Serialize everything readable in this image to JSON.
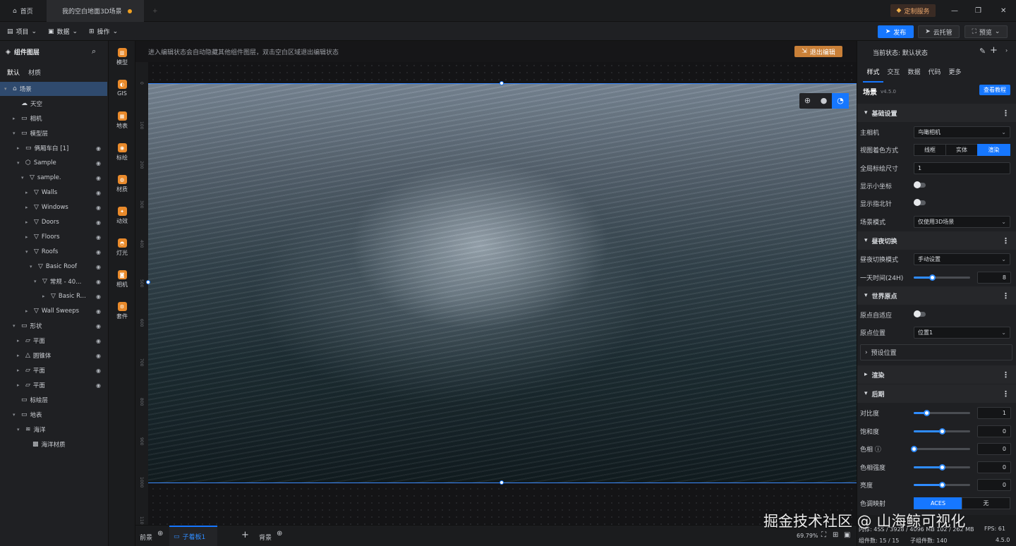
{
  "titlebar": {
    "home_tab": "首页",
    "scene_tab": "我的空白地面3D场景",
    "add_tab": "+",
    "custom_service": "定制服务",
    "min": "—",
    "max": "❐",
    "close": "✕"
  },
  "menubar": {
    "items": [
      "项目",
      "数据",
      "操作"
    ],
    "publish": "发布",
    "cloud_host": "云托管",
    "preview": "预览"
  },
  "layers": {
    "title": "组件图层",
    "tabs": [
      "默认",
      "材质"
    ],
    "items": [
      {
        "label": "场景",
        "icon": "scene"
      },
      {
        "label": "天空",
        "icon": "sky"
      },
      {
        "label": "相机",
        "icon": "folder"
      },
      {
        "label": "模型层",
        "icon": "folder"
      },
      {
        "label": "俩厢车白 [1]",
        "icon": "folder"
      },
      {
        "label": "Sample",
        "icon": "cube"
      },
      {
        "label": "sample.",
        "icon": "node"
      },
      {
        "label": "Walls",
        "icon": "node"
      },
      {
        "label": "Windows",
        "icon": "node"
      },
      {
        "label": "Doors",
        "icon": "node"
      },
      {
        "label": "Floors",
        "icon": "node"
      },
      {
        "label": "Roofs",
        "icon": "node"
      },
      {
        "label": "Basic Roof",
        "icon": "node"
      },
      {
        "label": "常规 - 40...",
        "icon": "node"
      },
      {
        "label": "Basic R...",
        "icon": "node"
      },
      {
        "label": "Wall Sweeps",
        "icon": "node"
      },
      {
        "label": "形状",
        "icon": "folder"
      },
      {
        "label": "平面",
        "icon": "plane"
      },
      {
        "label": "圆锥体",
        "icon": "cone"
      },
      {
        "label": "平面",
        "icon": "plane"
      },
      {
        "label": "平面",
        "icon": "plane"
      },
      {
        "label": "标绘层",
        "icon": "folder"
      },
      {
        "label": "地表",
        "icon": "folder"
      },
      {
        "label": "海洋",
        "icon": "ocean"
      },
      {
        "label": "海洋材质",
        "icon": "material"
      }
    ]
  },
  "toolbox": {
    "items": [
      "模型",
      "GIS",
      "地表",
      "标绘",
      "材质",
      "动效",
      "灯光",
      "相机",
      "套件"
    ]
  },
  "viewport": {
    "hint": "进入编辑状态会自动隐藏其他组件图层，双击空白区域退出编辑状态",
    "exit_edit": "退出编辑",
    "ruler_ticks": [
      "0",
      "100",
      "200",
      "300",
      "400",
      "500",
      "600",
      "700",
      "800",
      "900",
      "1000",
      "1100"
    ]
  },
  "bottombar": {
    "tabs": [
      "前景",
      "子着板1",
      "背景"
    ],
    "zoom": "69.79%"
  },
  "status": {
    "memory": "内存: 4SS / 3928 / 4096 MB 102 / 262 MB",
    "fps": "FPS: 61",
    "components": "组件数: 15 / 15",
    "sub_components": "子组件数: 140",
    "version": "4.5.0"
  },
  "right": {
    "state": "当前状态: 默认状态",
    "tabs": [
      "样式",
      "交互",
      "数据",
      "代码",
      "更多"
    ],
    "scene_title": "场景",
    "scene_version": "v4.5.0",
    "tutorial": "查看教程",
    "basic": {
      "title": "基础设置",
      "main_camera_label": "主相机",
      "main_camera": "鸟瞰相机",
      "shading_label": "视图着色方式",
      "shading_options": [
        "线框",
        "实体",
        "渲染"
      ],
      "marker_size_label": "全局标绘尺寸",
      "marker_size": "1",
      "show_axis": "显示小坐标",
      "show_compass": "显示指北针",
      "scene_mode_label": "场景模式",
      "scene_mode": "仅使用3D场景"
    },
    "daynight": {
      "title": "昼夜切换",
      "mode_label": "昼夜切换模式",
      "mode": "手动设置",
      "time_label": "一天时间(24H)",
      "time": "8",
      "time_fraction": 0.33
    },
    "origin": {
      "title": "世界原点",
      "adaptive": "原点自适应",
      "position_label": "原点位置",
      "position": "位置1",
      "preset": "预设位置"
    },
    "render": {
      "title": "渲染"
    },
    "post": {
      "title": "后期",
      "contrast": "对比度",
      "contrast_val": "1",
      "contrast_fraction": 0.22,
      "saturation": "饱和度",
      "saturation_val": "0",
      "saturation_fraction": 0.5,
      "hue": "色相",
      "hue_val": "0",
      "hue_fraction": 0.0,
      "hue_strength": "色相强度",
      "hue_strength_val": "0",
      "hue_strength_fraction": 0.5,
      "brightness": "亮度",
      "brightness_val": "0",
      "brightness_fraction": 0.5,
      "tonemap": "色调映射",
      "tonemap_options": [
        "ACES",
        "无"
      ]
    }
  },
  "watermark": "掘金技术社区 @ 山海鲸可视化",
  "colors": {
    "accent": "#1677ff",
    "orange": "#e98a2b",
    "bg": "#1f2023"
  }
}
